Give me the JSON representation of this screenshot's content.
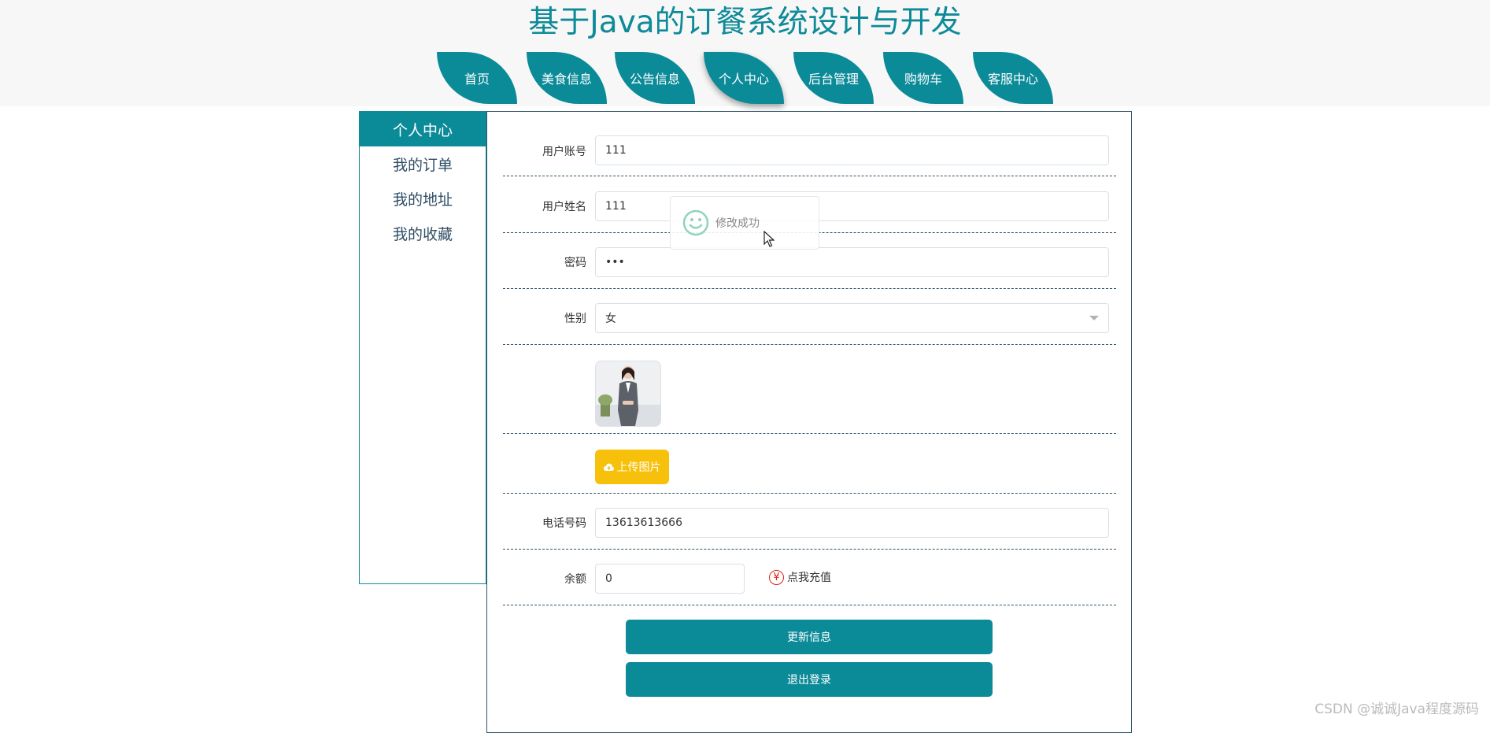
{
  "site": {
    "title": "基于Java的订餐系统设计与开发"
  },
  "nav": {
    "items": [
      {
        "label": "首页"
      },
      {
        "label": "美食信息"
      },
      {
        "label": "公告信息"
      },
      {
        "label": "个人中心",
        "active": true
      },
      {
        "label": "后台管理"
      },
      {
        "label": "购物车"
      },
      {
        "label": "客服中心"
      }
    ]
  },
  "sidebar": {
    "heading": "个人中心",
    "items": [
      {
        "label": "我的订单"
      },
      {
        "label": "我的地址"
      },
      {
        "label": "我的收藏"
      }
    ]
  },
  "form": {
    "account_label": "用户账号",
    "account_value": "111",
    "name_label": "用户姓名",
    "name_value": "111",
    "password_label": "密码",
    "password_value": "•••",
    "gender_label": "性别",
    "gender_value": "女",
    "upload_label": "上传图片",
    "phone_label": "电话号码",
    "phone_value": "13613613666",
    "balance_label": "余额",
    "balance_value": "0",
    "recharge_label": "点我充值",
    "recharge_icon": "¥",
    "update_label": "更新信息",
    "logout_label": "退出登录"
  },
  "toast": {
    "message": "修改成功"
  },
  "watermark": "CSDN @诚诚Java程度源码",
  "colors": {
    "accent": "#0b8a98",
    "upload": "#f7c00a",
    "recharge": "#d9241b"
  }
}
